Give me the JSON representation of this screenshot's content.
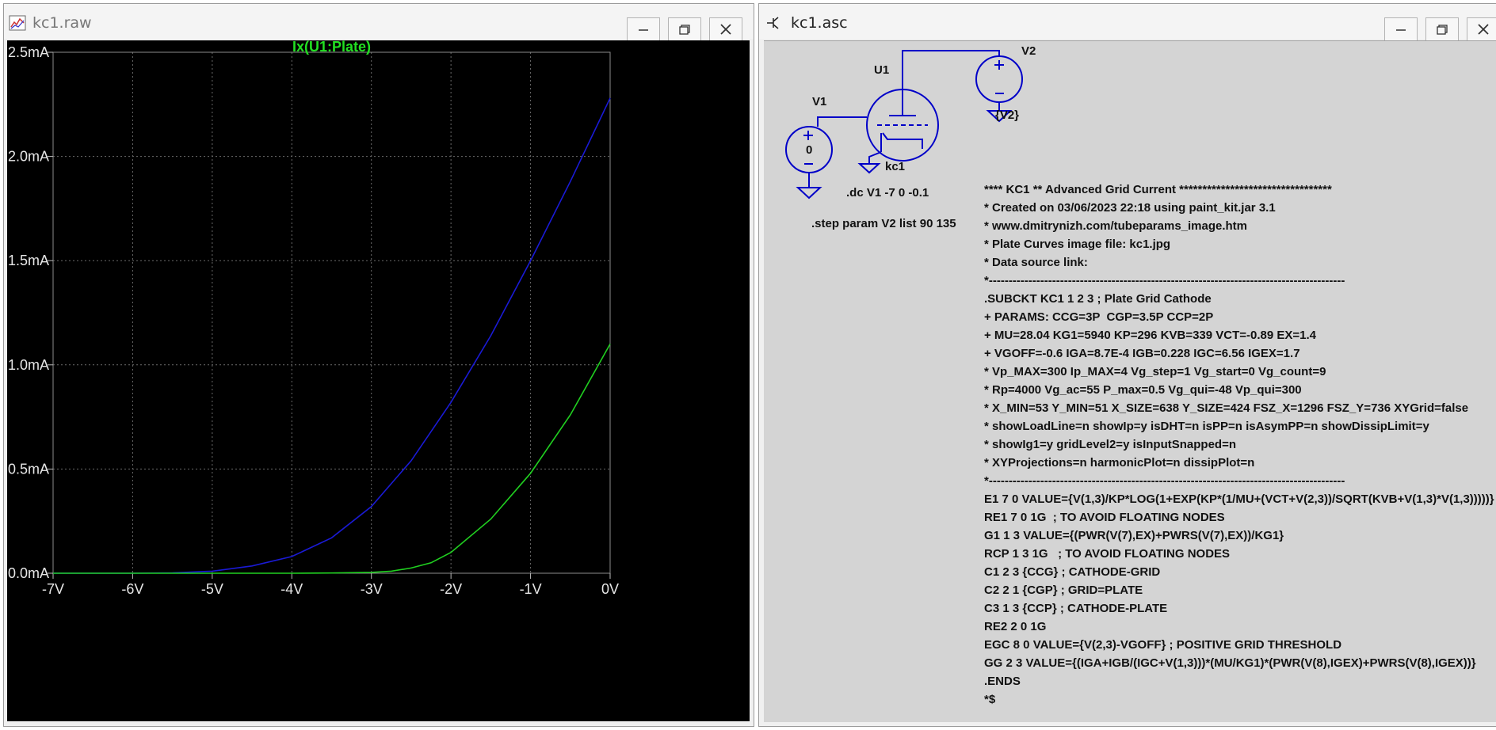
{
  "windows": {
    "raw": {
      "title": "kc1.raw"
    },
    "asc": {
      "title": "kc1.asc"
    }
  },
  "chart_data": {
    "type": "line",
    "title": "Ix(U1:Plate)",
    "xlabel": "",
    "ylabel": "",
    "xlim": [
      -7,
      0
    ],
    "ylim": [
      0,
      2.5
    ],
    "x_ticks": [
      "-7V",
      "-6V",
      "-5V",
      "-4V",
      "-3V",
      "-2V",
      "-1V",
      "0V"
    ],
    "y_ticks": [
      "0.0mA",
      "0.5mA",
      "1.0mA",
      "1.5mA",
      "2.0mA",
      "2.5mA"
    ],
    "grid": true,
    "series": [
      {
        "step": "V2=135",
        "color": "#1a1ad6",
        "x": [
          -7,
          -6,
          -5.5,
          -5,
          -4.5,
          -4,
          -3.5,
          -3,
          -2.5,
          -2,
          -1.5,
          -1,
          -0.5,
          0
        ],
        "y": [
          0,
          0,
          0.002,
          0.01,
          0.035,
          0.08,
          0.17,
          0.32,
          0.54,
          0.82,
          1.14,
          1.5,
          1.88,
          2.28
        ]
      },
      {
        "step": "V2=90",
        "color": "#20d020",
        "x": [
          -7,
          -5,
          -4,
          -3.5,
          -3,
          -2.75,
          -2.5,
          -2.25,
          -2,
          -1.5,
          -1,
          -0.5,
          0
        ],
        "y": [
          0,
          0,
          0,
          0.001,
          0.004,
          0.01,
          0.025,
          0.05,
          0.1,
          0.26,
          0.48,
          0.76,
          1.1
        ]
      }
    ]
  },
  "schematic": {
    "parts": {
      "u1": "U1",
      "v1": "V1",
      "v2": "V2",
      "v1_value": "0",
      "v2_value": "{V2}",
      "u1_model": "kc1"
    },
    "directives": {
      "dc": ".dc V1 -7 0 -0.1",
      "step": ".step param V2 list 90 135"
    },
    "netlist": [
      "**** KC1 ** Advanced Grid Current *********************************",
      "* Created on 03/06/2023 22:18 using paint_kit.jar 3.1",
      "* www.dmitrynizh.com/tubeparams_image.htm",
      "* Plate Curves image file: kc1.jpg",
      "* Data source link:",
      "*------------------------------------------------------------------------------------------",
      ".SUBCKT KC1 1 2 3 ; Plate Grid Cathode",
      "+ PARAMS: CCG=3P  CGP=3.5P CCP=2P",
      "+ MU=28.04 KG1=5940 KP=296 KVB=339 VCT=-0.89 EX=1.4",
      "+ VGOFF=-0.6 IGA=8.7E-4 IGB=0.228 IGC=6.56 IGEX=1.7",
      "* Vp_MAX=300 Ip_MAX=4 Vg_step=1 Vg_start=0 Vg_count=9",
      "* Rp=4000 Vg_ac=55 P_max=0.5 Vg_qui=-48 Vp_qui=300",
      "* X_MIN=53 Y_MIN=51 X_SIZE=638 Y_SIZE=424 FSZ_X=1296 FSZ_Y=736 XYGrid=false",
      "* showLoadLine=n showIp=y isDHT=n isPP=n isAsymPP=n showDissipLimit=y",
      "* showIg1=y gridLevel2=y isInputSnapped=n",
      "* XYProjections=n harmonicPlot=n dissipPlot=n",
      "*------------------------------------------------------------------------------------------",
      "E1 7 0 VALUE={V(1,3)/KP*LOG(1+EXP(KP*(1/MU+(VCT+V(2,3))/SQRT(KVB+V(1,3)*V(1,3)))))}",
      "RE1 7 0 1G  ; TO AVOID FLOATING NODES",
      "G1 1 3 VALUE={(PWR(V(7),EX)+PWRS(V(7),EX))/KG1}",
      "RCP 1 3 1G   ; TO AVOID FLOATING NODES",
      "C1 2 3 {CCG} ; CATHODE-GRID",
      "C2 2 1 {CGP} ; GRID=PLATE",
      "C3 1 3 {CCP} ; CATHODE-PLATE",
      "RE2 2 0 1G",
      "EGC 8 0 VALUE={V(2,3)-VGOFF} ; POSITIVE GRID THRESHOLD",
      "GG 2 3 VALUE={(IGA+IGB/(IGC+V(1,3)))*(MU/KG1)*(PWR(V(8),IGEX)+PWRS(V(8),IGEX))}",
      ".ENDS",
      "*$"
    ]
  }
}
